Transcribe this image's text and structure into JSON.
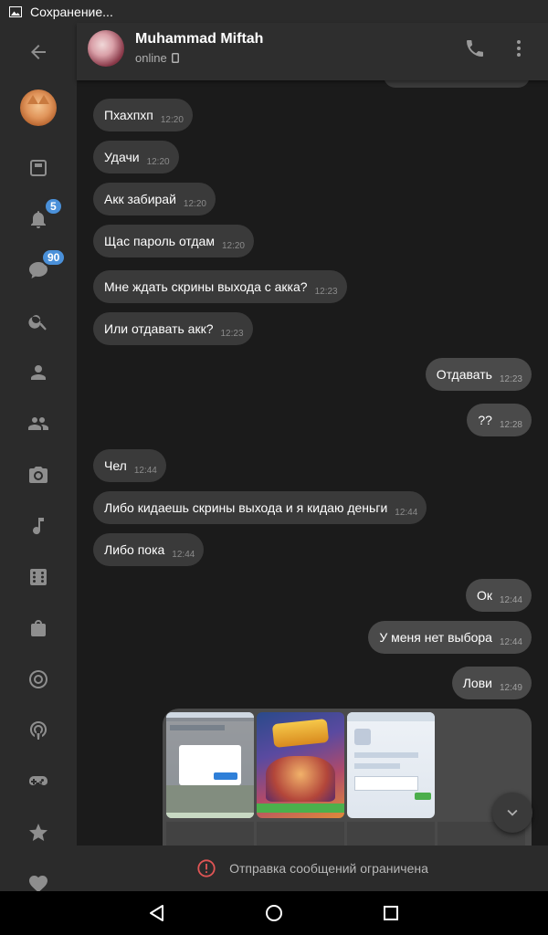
{
  "statusbar": {
    "text": "Сохранение..."
  },
  "sidebar": {
    "notifications_badge": "5",
    "messages_badge": "90"
  },
  "header": {
    "name": "Muhammad Miftah",
    "status": "online"
  },
  "messages": [
    {
      "dir": "in",
      "text": "Пхахпхп",
      "time": "12:20"
    },
    {
      "dir": "in",
      "text": "Удачи",
      "time": "12:20"
    },
    {
      "dir": "in",
      "text": "Акк забирай",
      "time": "12:20"
    },
    {
      "dir": "in",
      "text": "Щас пароль отдам",
      "time": "12:20"
    },
    {
      "dir": "in",
      "text": "Мне ждать скрины выхода с акка?",
      "time": "12:23"
    },
    {
      "dir": "in",
      "text": "Или отдавать акк?",
      "time": "12:23"
    },
    {
      "dir": "out",
      "text": "Отдавать",
      "time": "12:23"
    },
    {
      "dir": "out",
      "text": "??",
      "time": "12:28"
    },
    {
      "dir": "in",
      "text": "Чел",
      "time": "12:44"
    },
    {
      "dir": "in",
      "text": "Либо кидаешь скрины выхода и я кидаю деньги",
      "time": "12:44"
    },
    {
      "dir": "in",
      "text": "Либо пока",
      "time": "12:44"
    },
    {
      "dir": "out",
      "text": "Ок",
      "time": "12:44"
    },
    {
      "dir": "out",
      "text": "У меня нет выбора",
      "time": "12:44"
    },
    {
      "dir": "out",
      "text": "Лови",
      "time": "12:49"
    }
  ],
  "restriction_text": "Отправка сообщений ограничена",
  "icons": {
    "back": "arrow-left-icon",
    "call": "phone-icon",
    "more": "more-vertical-icon",
    "scroll": "chevron-down-icon",
    "warning": "alert-circle-icon"
  },
  "colors": {
    "sidebar_bg": "#2b2b2b",
    "chat_bg": "#1b1b1b",
    "bubble_in": "#3a3a3a",
    "bubble_out": "#4a4a4a",
    "badge": "#4a90d9",
    "warning": "#e05555"
  }
}
